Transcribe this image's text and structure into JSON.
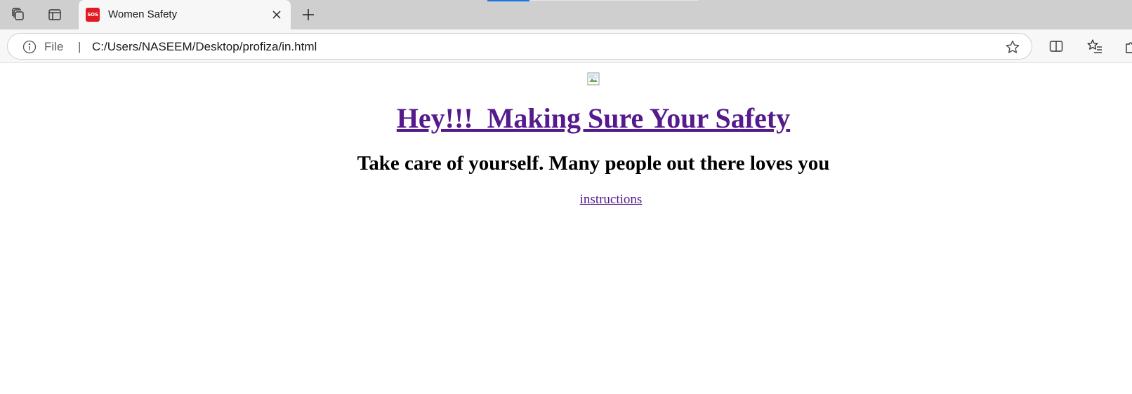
{
  "browser": {
    "tab": {
      "favicon_text": "SOS",
      "title": "Women Safety"
    },
    "address_bar": {
      "scheme_label": "File",
      "separator": "|",
      "url": "C:/Users/NASEEM/Desktop/profiza/in.html"
    },
    "icons": {
      "workspaces": "workspaces-icon",
      "tab_actions": "tab-actions-icon",
      "close": "close-icon",
      "new_tab": "plus-icon",
      "info": "info-icon",
      "favorite": "star-icon",
      "split_screen": "split-screen-icon",
      "favorites": "favorites-icon",
      "extensions": "extensions-icon"
    },
    "colors": {
      "tabstrip_bg": "#cfcfcf",
      "active_tab_bg": "#f7f7f7",
      "favicon_red": "#e21b23",
      "loading_blue": "#1a73e8"
    }
  },
  "page": {
    "heading": "Hey!!!  Making Sure Your Safety",
    "subheading": "Take care of yourself. Many people out there loves you",
    "instructions_link": "instructions",
    "colors": {
      "visited_link": "#551a8b",
      "text": "#000000"
    }
  }
}
